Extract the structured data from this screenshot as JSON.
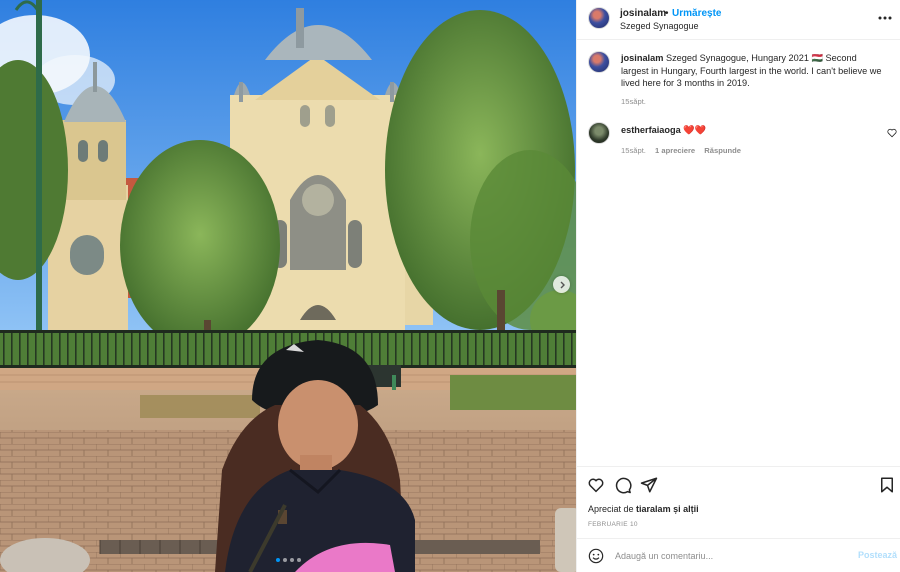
{
  "post": {
    "username": "josinalam",
    "separator": "•",
    "follow_label": "Urmărește",
    "location": "Szeged Synagogue"
  },
  "caption": {
    "username": "josinalam",
    "text": "Szeged Synagogue, Hungary 2021 🇭🇺 Second largest in Hungary, Fourth largest in the world. I can't believe we lived here for 3 months in 2019.",
    "time": "15săpt."
  },
  "comments": [
    {
      "username": "estherfaiaoga",
      "text": "❤️❤️",
      "time": "15săpt.",
      "likes": "1 apreciere",
      "reply_label": "Răspunde"
    }
  ],
  "likes": {
    "prefix": "Apreciat de",
    "user": "tiaralam",
    "suffix": "și alții"
  },
  "date": "FEBRUARIE 10",
  "add_comment": {
    "placeholder": "Adaugă un comentariu...",
    "post_label": "Postează"
  },
  "carousel": {
    "count": 4,
    "active_index": 0
  },
  "icons": {
    "more": "more-horizontal-icon",
    "like": "heart-outline-icon",
    "comment": "comment-bubble-icon",
    "share": "paper-plane-icon",
    "save": "bookmark-icon",
    "emoji": "emoji-icon",
    "next": "chevron-right-icon"
  },
  "colors": {
    "accent": "#0095f6",
    "post_disabled": "#b2dffc",
    "heart_red": "#ed4956",
    "secondary_text": "#8e8e8e"
  }
}
